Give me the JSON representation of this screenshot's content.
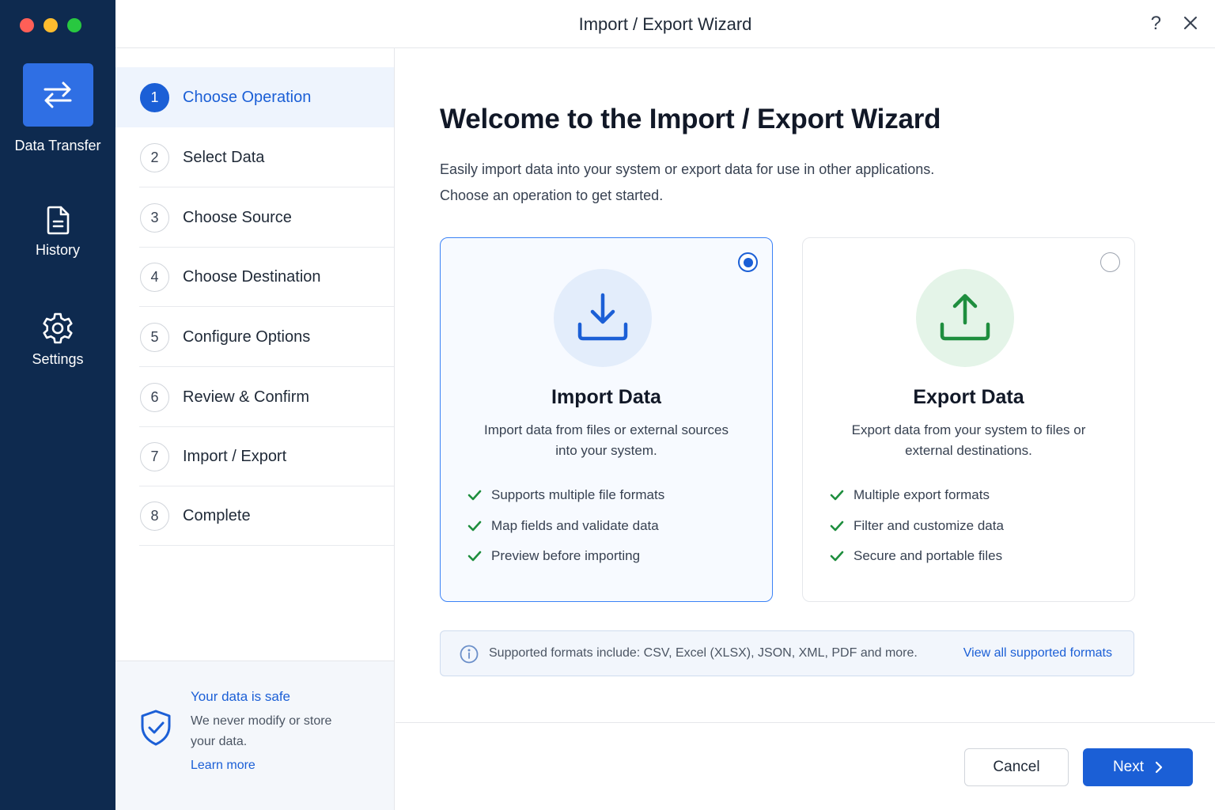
{
  "window": {
    "title": "Import / Export Wizard",
    "help_glyph": "?"
  },
  "rail": {
    "items": [
      {
        "label": "Data Transfer",
        "icon": "transfer-arrows-icon",
        "active": true
      },
      {
        "label": "History",
        "icon": "document-icon",
        "active": false
      },
      {
        "label": "Settings",
        "icon": "gear-icon",
        "active": false
      }
    ]
  },
  "steps": [
    {
      "number": "1",
      "label": "Choose Operation",
      "active": true
    },
    {
      "number": "2",
      "label": "Select Data"
    },
    {
      "number": "3",
      "label": "Choose Source"
    },
    {
      "number": "4",
      "label": "Choose Destination"
    },
    {
      "number": "5",
      "label": "Configure Options"
    },
    {
      "number": "6",
      "label": "Review & Confirm"
    },
    {
      "number": "7",
      "label": "Import / Export"
    },
    {
      "number": "8",
      "label": "Complete"
    }
  ],
  "safety": {
    "title": "Your data is safe",
    "body": "We never modify or store your data.",
    "link": "Learn more"
  },
  "main": {
    "heading": "Welcome to the Import / Export Wizard",
    "intro_line1": "Easily import data into your system or export data for use in other applications.",
    "intro_line2": "Choose an operation to get started."
  },
  "cards": {
    "import": {
      "title": "Import Data",
      "description": "Import data from files or external sources into your system.",
      "features": [
        "Supports multiple file formats",
        "Map fields and validate data",
        "Preview before importing"
      ],
      "selected": true,
      "icon": "download-icon"
    },
    "export": {
      "title": "Export Data",
      "description": "Export data from your system to files or external destinations.",
      "features": [
        "Multiple export formats",
        "Filter and customize data",
        "Secure and portable files"
      ],
      "selected": false,
      "icon": "upload-icon"
    }
  },
  "info": {
    "text": "Supported formats include: CSV, Excel (XLSX), JSON, XML, PDF and more.",
    "link": "View all supported formats"
  },
  "footer": {
    "cancel": "Cancel",
    "next": "Next"
  },
  "colors": {
    "accent": "#1b5fd6",
    "rail": "#0e2a4f",
    "success": "#1e8e3e"
  }
}
